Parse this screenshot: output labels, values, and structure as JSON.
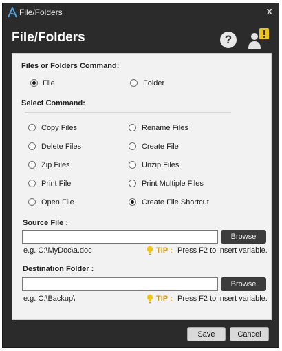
{
  "window": {
    "title": "File/Folders",
    "close_glyph": "x",
    "app_icon": "a-logo-icon"
  },
  "header": {
    "heading": "File/Folders",
    "help_glyph": "?",
    "help_icon": "question-icon",
    "alert_icon": "user-alert-icon"
  },
  "type_section": {
    "label": "Files or Folders Command:",
    "options": [
      {
        "label": "File",
        "checked": true
      },
      {
        "label": "Folder",
        "checked": false
      }
    ]
  },
  "command_section": {
    "label": "Select Command:",
    "options": [
      {
        "label": "Copy Files",
        "checked": false
      },
      {
        "label": "Rename Files",
        "checked": false
      },
      {
        "label": "Delete Files",
        "checked": false
      },
      {
        "label": "Create File",
        "checked": false
      },
      {
        "label": "Zip Files",
        "checked": false
      },
      {
        "label": "Unzip Files",
        "checked": false
      },
      {
        "label": "Print File",
        "checked": false
      },
      {
        "label": "Print Multiple Files",
        "checked": false
      },
      {
        "label": "Open File",
        "checked": false
      },
      {
        "label": "Create File Shortcut",
        "checked": true
      }
    ]
  },
  "source": {
    "label": "Source File :",
    "value": "",
    "browse_label": "Browse",
    "example": "e.g. C:\\MyDoc\\a.doc",
    "tip_label": "TIP :",
    "tip_text": "Press F2 to insert variable."
  },
  "destination": {
    "label": "Destination Folder :",
    "value": "",
    "browse_label": "Browse",
    "example": "e.g. C:\\Backup\\",
    "tip_label": "TIP :",
    "tip_text": "Press F2 to insert variable."
  },
  "footer": {
    "save_label": "Save",
    "cancel_label": "Cancel"
  },
  "colors": {
    "titlebar_bg": "#2b2b2b",
    "panel_bg": "#f2f2f2",
    "tip_color": "#d89a14",
    "dark_button": "#3c3c3c",
    "alert_accent": "#f0c419"
  }
}
